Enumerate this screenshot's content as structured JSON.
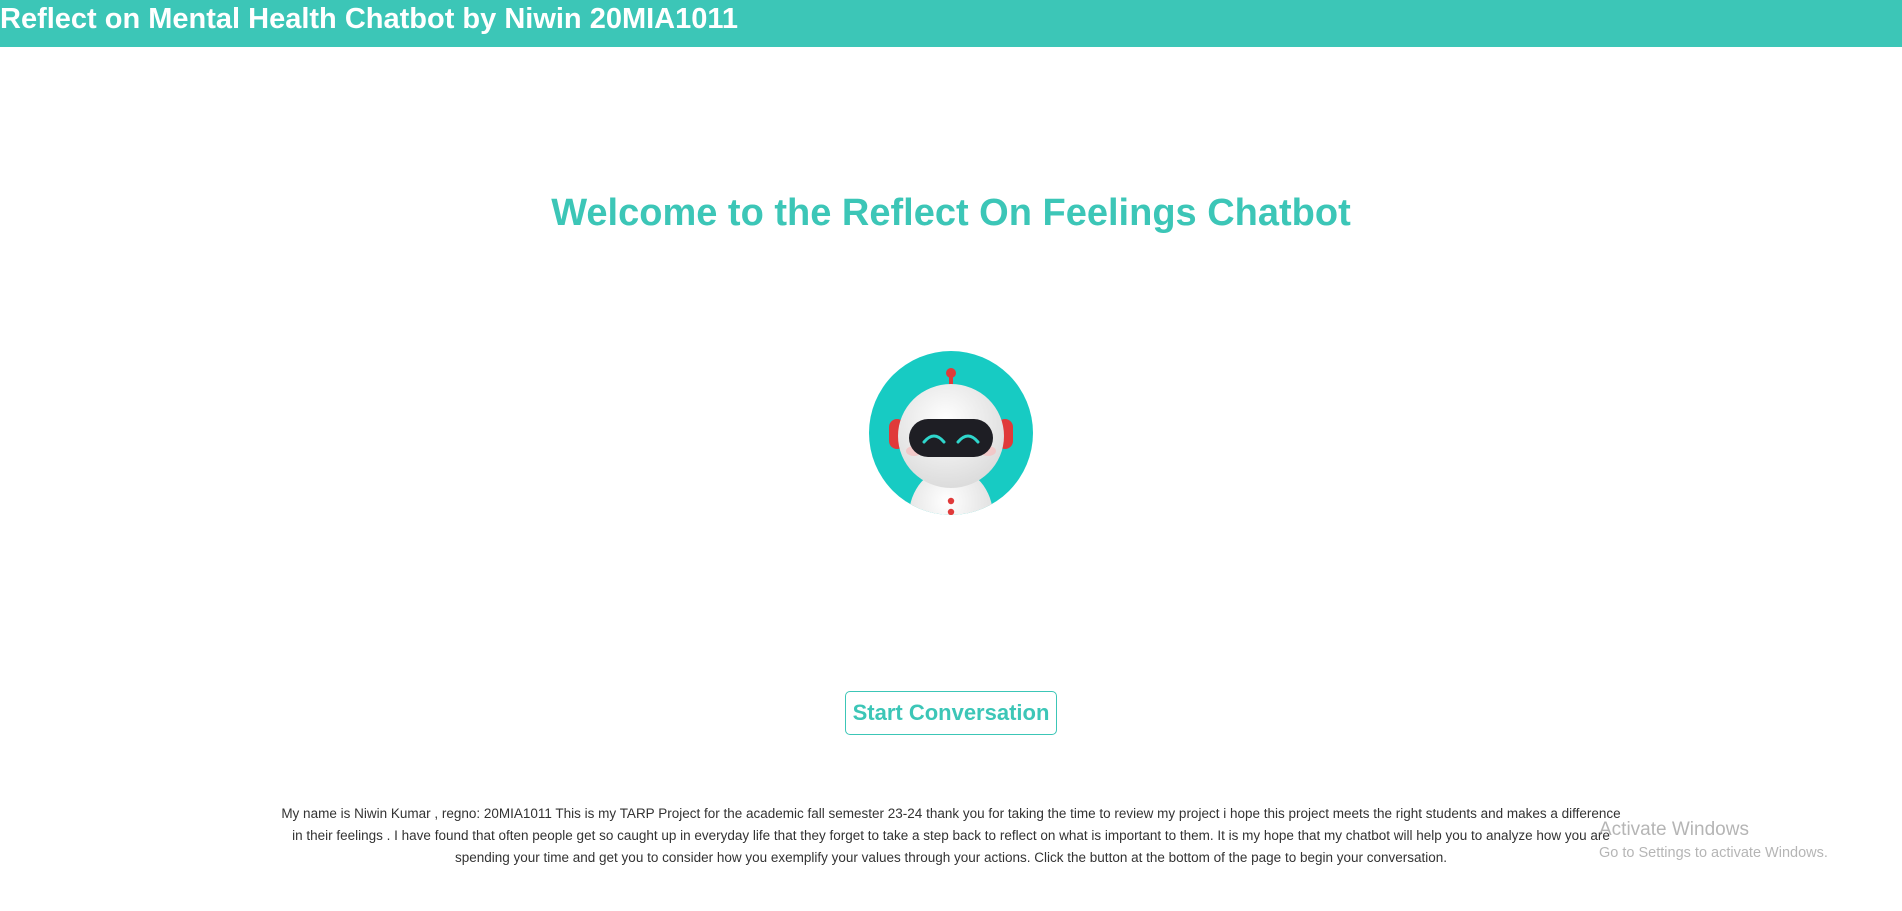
{
  "header": {
    "title": "Reflect on Mental Health Chatbot by Niwin 20MIA1011",
    "background_color": "#3cc6b7"
  },
  "main": {
    "welcome_heading": "Welcome to the Reflect On Feelings Chatbot",
    "avatar_icon": "robot-icon",
    "start_button_label": "Start Conversation",
    "accent_color": "#3cc6b7",
    "about_text": "My name is Niwin Kumar , regno: 20MIA1011 This is my TARP Project for the academic fall semester 23-24 thank you for taking the time to review my project i hope this project meets the right students and makes a difference in their feelings . I have found that often people get so caught up in everyday life that they forget to take a step back to reflect on what is important to them. It is my hope that my chatbot will help you to analyze how you are spending your time and get you to consider how you exemplify your values through your actions. Click the button at the bottom of the page to begin your conversation."
  },
  "os_watermark": {
    "title": "Activate Windows",
    "subtitle": "Go to Settings to activate Windows."
  }
}
